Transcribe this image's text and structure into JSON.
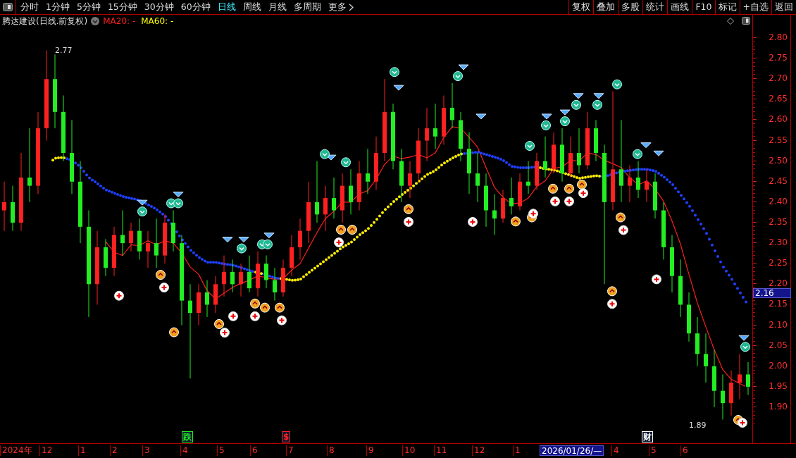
{
  "toolbar": {
    "periods": [
      {
        "label": "分时",
        "selected": false
      },
      {
        "label": "1分钟",
        "selected": false
      },
      {
        "label": "5分钟",
        "selected": false
      },
      {
        "label": "15分钟",
        "selected": false
      },
      {
        "label": "30分钟",
        "selected": false
      },
      {
        "label": "60分钟",
        "selected": false
      },
      {
        "label": "日线",
        "selected": true
      },
      {
        "label": "周线",
        "selected": false
      },
      {
        "label": "月线",
        "selected": false
      },
      {
        "label": "多周期",
        "selected": false
      },
      {
        "label": "更多",
        "selected": false
      }
    ],
    "actions": [
      "复权",
      "叠加",
      "多股",
      "统计",
      "画线",
      "F10",
      "标记",
      "+自选",
      "返回"
    ]
  },
  "header": {
    "title": "腾达建设(日线.前复权)",
    "indicators": [
      {
        "label": "MA20: -",
        "color": "#ff2020"
      },
      {
        "label": "MA60: -",
        "color": "#ffff00"
      }
    ]
  },
  "chart": {
    "high_label": "2.77",
    "low_label": "1.89",
    "current_price": "2.16",
    "chart_data": {
      "type": "candlestick",
      "ylim": [
        1.811,
        2.856
      ],
      "yticks": [
        {
          "value": 2.8,
          "label": "2.80"
        },
        {
          "value": 2.75,
          "label": "2.75"
        },
        {
          "value": 2.7,
          "label": "2.70"
        },
        {
          "value": 2.65,
          "label": "2.65"
        },
        {
          "value": 2.6,
          "label": "2.60"
        },
        {
          "value": 2.55,
          "label": "2.55"
        },
        {
          "value": 2.5,
          "label": "2.50"
        },
        {
          "value": 2.45,
          "label": "2.45"
        },
        {
          "value": 2.4,
          "label": "2.40"
        },
        {
          "value": 2.35,
          "label": "2.35"
        },
        {
          "value": 2.3,
          "label": "2.30"
        },
        {
          "value": 2.25,
          "label": "2.25"
        },
        {
          "value": 2.2,
          "label": "2.20"
        },
        {
          "value": 2.15,
          "label": "2.15"
        },
        {
          "value": 2.1,
          "label": "2.10"
        },
        {
          "value": 2.05,
          "label": "2.05"
        },
        {
          "value": 2.0,
          "label": "2.00"
        },
        {
          "value": 1.95,
          "label": "1.95"
        },
        {
          "value": 1.9,
          "label": "1.90"
        }
      ],
      "ohlc": [
        [
          2.38,
          2.45,
          2.33,
          2.4
        ],
        [
          2.4,
          2.44,
          2.33,
          2.35
        ],
        [
          2.35,
          2.52,
          2.33,
          2.46
        ],
        [
          2.46,
          2.58,
          2.4,
          2.44
        ],
        [
          2.44,
          2.62,
          2.42,
          2.58
        ],
        [
          2.58,
          2.77,
          2.55,
          2.7
        ],
        [
          2.7,
          2.76,
          2.58,
          2.62
        ],
        [
          2.62,
          2.66,
          2.5,
          2.52
        ],
        [
          2.52,
          2.6,
          2.42,
          2.45
        ],
        [
          2.45,
          2.5,
          2.3,
          2.34
        ],
        [
          2.34,
          2.38,
          2.12,
          2.2
        ],
        [
          2.2,
          2.33,
          2.15,
          2.29
        ],
        [
          2.29,
          2.31,
          2.22,
          2.24
        ],
        [
          2.24,
          2.34,
          2.22,
          2.32
        ],
        [
          2.32,
          2.38,
          2.27,
          2.3
        ],
        [
          2.3,
          2.35,
          2.28,
          2.33
        ],
        [
          2.33,
          2.36,
          2.26,
          2.28
        ],
        [
          2.28,
          2.33,
          2.24,
          2.3
        ],
        [
          2.3,
          2.36,
          2.24,
          2.27
        ],
        [
          2.27,
          2.37,
          2.25,
          2.35
        ],
        [
          2.35,
          2.38,
          2.28,
          2.3
        ],
        [
          2.3,
          2.32,
          2.1,
          2.16
        ],
        [
          2.16,
          2.2,
          1.97,
          2.13
        ],
        [
          2.13,
          2.2,
          2.1,
          2.18
        ],
        [
          2.18,
          2.21,
          2.12,
          2.15
        ],
        [
          2.15,
          2.22,
          2.13,
          2.2
        ],
        [
          2.2,
          2.27,
          2.17,
          2.23
        ],
        [
          2.23,
          2.26,
          2.18,
          2.2
        ],
        [
          2.2,
          2.25,
          2.17,
          2.23
        ],
        [
          2.23,
          2.27,
          2.18,
          2.19
        ],
        [
          2.19,
          2.28,
          2.17,
          2.25
        ],
        [
          2.25,
          2.27,
          2.19,
          2.21
        ],
        [
          2.21,
          2.24,
          2.16,
          2.18
        ],
        [
          2.18,
          2.26,
          2.17,
          2.24
        ],
        [
          2.24,
          2.32,
          2.22,
          2.29
        ],
        [
          2.29,
          2.36,
          2.26,
          2.33
        ],
        [
          2.33,
          2.45,
          2.3,
          2.4
        ],
        [
          2.4,
          2.5,
          2.35,
          2.37
        ],
        [
          2.37,
          2.44,
          2.33,
          2.41
        ],
        [
          2.41,
          2.46,
          2.36,
          2.38
        ],
        [
          2.38,
          2.47,
          2.35,
          2.44
        ],
        [
          2.44,
          2.48,
          2.37,
          2.4
        ],
        [
          2.4,
          2.5,
          2.38,
          2.47
        ],
        [
          2.47,
          2.53,
          2.42,
          2.45
        ],
        [
          2.45,
          2.56,
          2.43,
          2.52
        ],
        [
          2.52,
          2.7,
          2.5,
          2.62
        ],
        [
          2.62,
          2.64,
          2.48,
          2.5
        ],
        [
          2.5,
          2.53,
          2.4,
          2.44
        ],
        [
          2.44,
          2.5,
          2.41,
          2.47
        ],
        [
          2.47,
          2.58,
          2.45,
          2.55
        ],
        [
          2.55,
          2.63,
          2.5,
          2.58
        ],
        [
          2.58,
          2.64,
          2.53,
          2.56
        ],
        [
          2.56,
          2.66,
          2.54,
          2.63
        ],
        [
          2.63,
          2.69,
          2.58,
          2.6
        ],
        [
          2.6,
          2.62,
          2.5,
          2.53
        ],
        [
          2.53,
          2.57,
          2.42,
          2.47
        ],
        [
          2.47,
          2.52,
          2.4,
          2.44
        ],
        [
          2.44,
          2.47,
          2.34,
          2.38
        ],
        [
          2.38,
          2.42,
          2.32,
          2.36
        ],
        [
          2.36,
          2.43,
          2.35,
          2.41
        ],
        [
          2.41,
          2.46,
          2.37,
          2.39
        ],
        [
          2.39,
          2.47,
          2.38,
          2.45
        ],
        [
          2.45,
          2.5,
          2.42,
          2.44
        ],
        [
          2.44,
          2.52,
          2.43,
          2.5
        ],
        [
          2.5,
          2.56,
          2.46,
          2.48
        ],
        [
          2.48,
          2.57,
          2.47,
          2.54
        ],
        [
          2.54,
          2.58,
          2.45,
          2.47
        ],
        [
          2.47,
          2.56,
          2.46,
          2.52
        ],
        [
          2.52,
          2.58,
          2.47,
          2.49
        ],
        [
          2.49,
          2.62,
          2.48,
          2.58
        ],
        [
          2.58,
          2.6,
          2.5,
          2.52
        ],
        [
          2.52,
          2.54,
          2.2,
          2.4
        ],
        [
          2.4,
          2.67,
          2.38,
          2.48
        ],
        [
          2.48,
          2.6,
          2.4,
          2.44
        ],
        [
          2.44,
          2.49,
          2.4,
          2.46
        ],
        [
          2.46,
          2.5,
          2.41,
          2.43
        ],
        [
          2.43,
          2.48,
          2.4,
          2.45
        ],
        [
          2.45,
          2.47,
          2.36,
          2.38
        ],
        [
          2.38,
          2.4,
          2.26,
          2.29
        ],
        [
          2.29,
          2.32,
          2.18,
          2.22
        ],
        [
          2.22,
          2.26,
          2.12,
          2.15
        ],
        [
          2.15,
          2.18,
          2.06,
          2.08
        ],
        [
          2.08,
          2.12,
          2.0,
          2.03
        ],
        [
          2.03,
          2.08,
          1.96,
          2.0
        ],
        [
          2.0,
          2.04,
          1.9,
          1.94
        ],
        [
          1.94,
          1.98,
          1.87,
          1.91
        ],
        [
          1.91,
          1.99,
          1.88,
          1.96
        ],
        [
          1.96,
          2.03,
          1.92,
          1.98
        ],
        [
          1.98,
          2.01,
          1.93,
          1.95
        ]
      ]
    }
  },
  "events": [
    {
      "label": "跌",
      "color": "#22ee22"
    },
    {
      "label": "$",
      "color": "#ff2020"
    },
    {
      "label": "财",
      "color": "#ffffff"
    }
  ],
  "dates": [
    {
      "label": "2024年",
      "selected": false
    },
    {
      "label": "12",
      "selected": false
    },
    {
      "label": "1",
      "selected": false
    },
    {
      "label": "2",
      "selected": false
    },
    {
      "label": "3",
      "selected": false
    },
    {
      "label": "4",
      "selected": false
    },
    {
      "label": "5",
      "selected": false
    },
    {
      "label": "6",
      "selected": false
    },
    {
      "label": "7",
      "selected": false
    },
    {
      "label": "8",
      "selected": false
    },
    {
      "label": "9",
      "selected": false
    },
    {
      "label": "10",
      "selected": false
    },
    {
      "label": "11",
      "selected": false
    },
    {
      "label": "12",
      "selected": false
    },
    {
      "label": "1",
      "selected": false
    },
    {
      "label": "2026/01/26/—",
      "selected": true
    },
    {
      "label": "4",
      "selected": false
    },
    {
      "label": "5",
      "selected": false
    },
    {
      "label": "6",
      "selected": false
    }
  ]
}
